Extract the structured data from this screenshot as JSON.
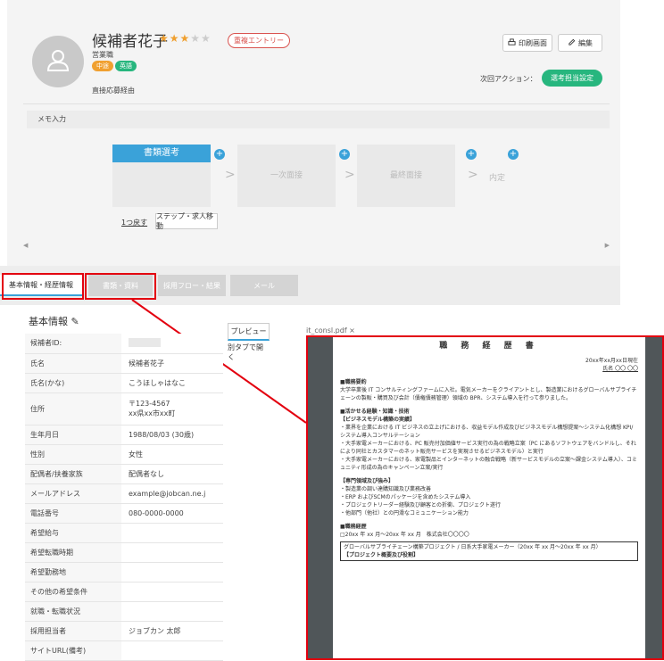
{
  "candidate": {
    "name": "候補者花子",
    "rating": 3,
    "rating_max": 5,
    "entry_badge": "重複エントリー",
    "dept": "営業職",
    "tags": [
      {
        "text": "中途",
        "color": "#f0a030"
      },
      {
        "text": "英語",
        "color": "#27b67e"
      }
    ],
    "route": "直接応募経由"
  },
  "header_buttons": {
    "print": "印刷画面",
    "edit": "編集"
  },
  "next_action": {
    "label": "次回アクション：",
    "button": "選考担当設定"
  },
  "memo": "メモ入力",
  "stages": {
    "first": "書類選考",
    "second": "一次面接",
    "third": "最終面接",
    "fourth": "内定"
  },
  "stage_actions": {
    "back": "1つ戻す",
    "move": "ステップ・求人移動"
  },
  "tabs": [
    "基本情報・経歴情報",
    "書類・資料",
    "採用フロー・結果",
    "メール"
  ],
  "section": {
    "title": "基本情報"
  },
  "fields": [
    {
      "k": "候補者ID:",
      "v": ""
    },
    {
      "k": "氏名",
      "v": "候補者花子"
    },
    {
      "k": "氏名(かな)",
      "v": "こうほしゃはなこ"
    },
    {
      "k": "住所",
      "v": "〒123-4567",
      "v2": "xx県xx市xx町"
    },
    {
      "k": "生年月日",
      "v": "1988/08/03 (30歳)"
    },
    {
      "k": "性別",
      "v": "女性"
    },
    {
      "k": "配偶者/扶養家族",
      "v": "配偶者なし"
    },
    {
      "k": "メールアドレス",
      "v": "example@jobcan.ne.j"
    },
    {
      "k": "電話番号",
      "v": "080-0000-0000"
    },
    {
      "k": "希望給与",
      "v": ""
    },
    {
      "k": "希望転職時期",
      "v": ""
    },
    {
      "k": "希望勤務地",
      "v": ""
    },
    {
      "k": "その他の希望条件",
      "v": ""
    },
    {
      "k": "就職・転職状況",
      "v": ""
    },
    {
      "k": "採用担当者",
      "v": "ジョブカン 太郎"
    },
    {
      "k": "サイトURL(備考)",
      "v": ""
    }
  ],
  "preview": {
    "tab": "プレビュー",
    "open_new": "別タブで開く",
    "filename": "it_consl.pdf ×"
  },
  "doc": {
    "title": "職 務 経 歴 書",
    "date": "20xx年xx月xx日現在",
    "name": "氏名 〇〇 〇〇",
    "h1": "■職務要約",
    "summary": "大学卒業後 IT コンサルティングファームに入社。電気メーカーをクライアントとし、製造業におけるグローバルサプライチェーンの製販・購買及び会計（債権債務管理）領域の BPR、システム導入を行って参りました。",
    "h2": "■活かせる経験・知識・技術",
    "s1": "【ビジネスモデル構築の実績】",
    "b1": "・業界を企業における IT ビジネスの立上げにおける、収益モデル作成及びビジネスモデル構想提案～システム化構想 KPI/システム導入コンサルテーション",
    "b2": "・大手家電メーカーにおける、PC 販売付加価値サービス実行の為の戦略立案（PC にあるソフトウェアをバンドルし、それにより同社とカスタマーのネット販売サービスを実現させるビジネスモデル）と実行",
    "b3": "・大手家電メーカーにおける、家電製品とインターネットの融合戦略（新サービスモデルの立案～課金システム導入）、コミュニティ形成の為のキャンペーン立案/実行",
    "s2": "【専門領域及び強み】",
    "c1": "・製造業の調い達購知識及び業務改善",
    "c2": "・ERP およびSCMのパッケージを含めたシステム導入",
    "c3": "・プロジェクトリーダー経験及び顧客との折衝、プロジェクト遂行",
    "c4": "・他部門（他社）との円滑なコミュニケーション能力",
    "h3": "■職務経歴",
    "e1": "□20xx 年 xx 月～20xx 年 xx 月　株式会社〇〇〇〇",
    "t1": "グローバルサプライチェーン構築プロジェクト / 日系大手家電メーカー（20xx 年 xx 月～20xx 年 xx 月）",
    "t2": "【プロジェクト概要及び役割】"
  }
}
